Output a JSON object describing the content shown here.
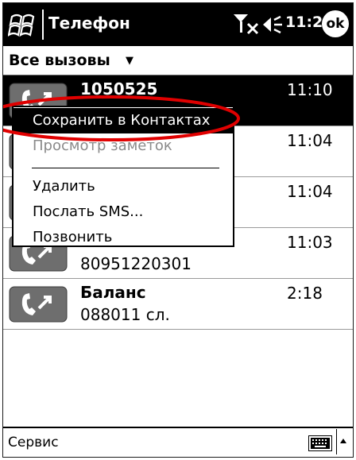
{
  "title_bar": {
    "title": "Телефон",
    "clock": "11:28",
    "ok_label": "ok"
  },
  "filter": {
    "label": "Все вызовы"
  },
  "calls": [
    {
      "name": "1050525",
      "number": "",
      "time": "11:10",
      "selected": true
    },
    {
      "name": "",
      "number": "",
      "time": "11:04",
      "selected": false
    },
    {
      "name": "",
      "number": "",
      "time": "11:04",
      "selected": false
    },
    {
      "name": "",
      "number": "80951220301",
      "time": "11:03",
      "selected": false
    },
    {
      "name": "Баланс",
      "number": "088011 сл.",
      "time": "2:18",
      "selected": false
    }
  ],
  "context_menu": {
    "items": [
      {
        "label": "Сохранить в Контактах",
        "state": "highlighted"
      },
      {
        "label": "Просмотр заметок",
        "state": "disabled"
      },
      {
        "label": "Удалить",
        "state": "enabled"
      },
      {
        "label": "Послать SMS...",
        "state": "enabled"
      },
      {
        "label": "Позвонить",
        "state": "enabled"
      }
    ]
  },
  "toolbar": {
    "menu_label": "Сервис"
  },
  "colors": {
    "title_bar": "#000000",
    "selection": "#000000",
    "highlight_ring": "#e00000",
    "disabled_text": "#8a8a8a"
  },
  "icons": [
    "windows-start-icon",
    "signal-off-icon",
    "volume-icon",
    "ok-button",
    "call-outgoing-icon",
    "keyboard-icon",
    "sip-arrow-icon"
  ]
}
